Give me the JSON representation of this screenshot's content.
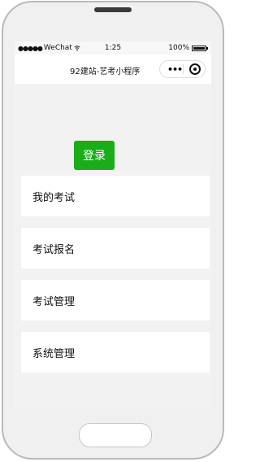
{
  "status": {
    "carrier": "WeChat",
    "time": "1:25",
    "battery": "100%",
    "battery_level": 1.0
  },
  "nav": {
    "title": "92建站-艺考小程序"
  },
  "login_label": "登录",
  "menu": [
    {
      "label": "我的考试"
    },
    {
      "label": "考试报名"
    },
    {
      "label": "考试管理"
    },
    {
      "label": "系统管理"
    }
  ]
}
